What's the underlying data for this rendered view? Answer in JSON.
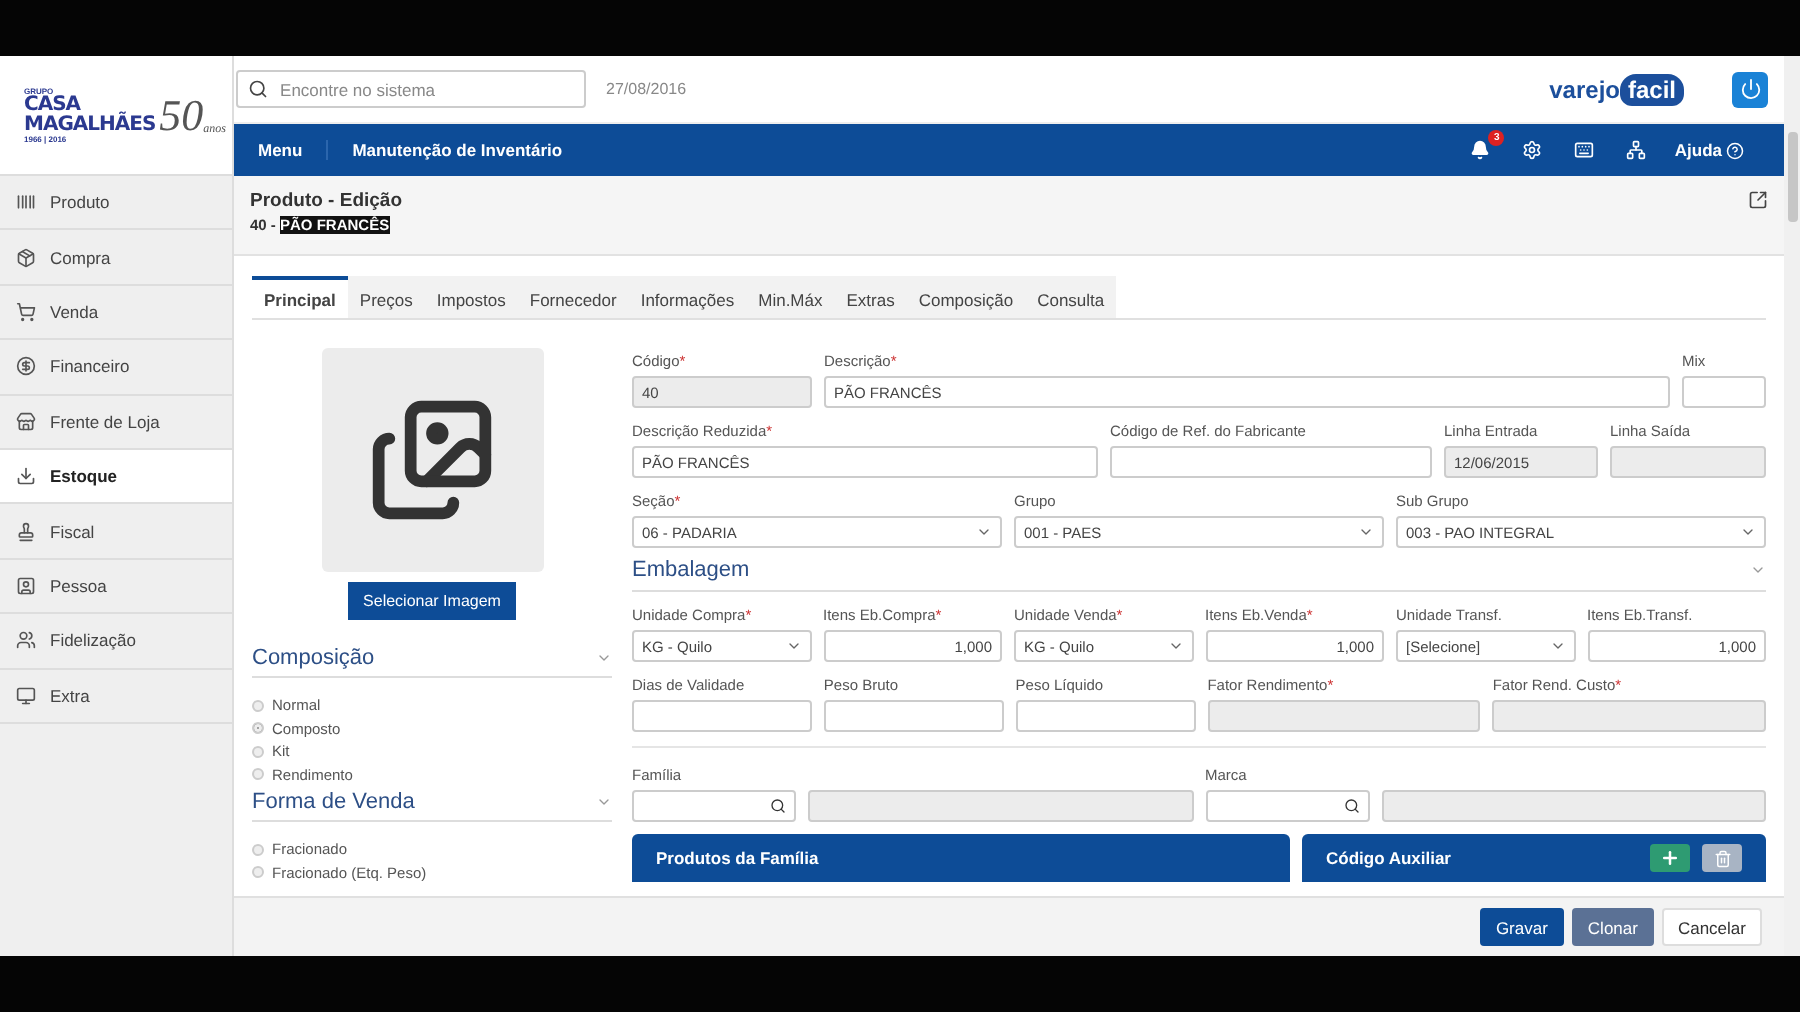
{
  "logo": {
    "group": "GRUPO",
    "line1": "CASA",
    "line2": "MAGALHÃES",
    "years": "1966 | 2016",
    "anniversary": "50",
    "anos": "anos"
  },
  "sidebar": {
    "items": [
      {
        "label": "Produto",
        "selected": false
      },
      {
        "label": "Compra",
        "selected": false
      },
      {
        "label": "Venda",
        "selected": false
      },
      {
        "label": "Financeiro",
        "selected": false
      },
      {
        "label": "Frente de Loja",
        "selected": false
      },
      {
        "label": "Estoque",
        "selected": true
      },
      {
        "label": "Fiscal",
        "selected": false
      },
      {
        "label": "Pessoa",
        "selected": false
      },
      {
        "label": "Fidelização",
        "selected": false
      },
      {
        "label": "Extra",
        "selected": false
      }
    ]
  },
  "topbar": {
    "search": {
      "placeholder": "Encontre no sistema"
    },
    "date": "27/08/2016",
    "brand": {
      "part1": "varejo",
      "part2": "facil"
    }
  },
  "navbar": {
    "menu": "Menu",
    "title": "Manutenção de Inventário",
    "notifications": "3",
    "help": "Ajuda"
  },
  "page": {
    "title": "Produto - Edição",
    "subtitle": {
      "prefix": "40 - ",
      "name": "PÃO FRANCÊS",
      "selected": true
    }
  },
  "tabs": [
    {
      "label": "Principal",
      "selected": true
    },
    {
      "label": "Preços",
      "selected": false
    },
    {
      "label": "Impostos",
      "selected": false
    },
    {
      "label": "Fornecedor",
      "selected": false
    },
    {
      "label": "Informações",
      "selected": false
    },
    {
      "label": "Min.Máx",
      "selected": false
    },
    {
      "label": "Extras",
      "selected": false
    },
    {
      "label": "Composição",
      "selected": false
    },
    {
      "label": "Consulta",
      "selected": false
    }
  ],
  "left": {
    "image_button": "Selecionar Imagem",
    "sections": [
      {
        "title": "Composição",
        "options": [
          {
            "label": "Normal",
            "selected": false
          },
          {
            "label": "Composto",
            "selected": true
          },
          {
            "label": "Kit",
            "selected": false
          },
          {
            "label": "Rendimento",
            "selected": false
          }
        ]
      },
      {
        "title": "Forma de Venda",
        "options": [
          {
            "label": "Fracionado",
            "selected": false
          },
          {
            "label": "Fracionado (Etq. Peso)",
            "selected": false
          }
        ]
      }
    ]
  },
  "form": {
    "rows": [
      [
        {
          "label": "Código",
          "required_mark": "*",
          "kind": "text",
          "value": "40",
          "disabled": true
        },
        {
          "label": "Descrição",
          "required_mark": "*",
          "kind": "text",
          "value": "PÃO FRANCÊS",
          "disabled": false
        },
        {
          "label": "Mix",
          "kind": "text",
          "disabled": false
        }
      ],
      [
        {
          "label": "Descrição Reduzida",
          "required_mark": "*",
          "kind": "text",
          "value": "PÃO FRANCÊS",
          "disabled": false
        },
        {
          "label": "Código de Ref. do Fabricante",
          "kind": "text",
          "disabled": false
        },
        {
          "label": "Linha Entrada",
          "kind": "text",
          "value": "12/06/2015",
          "disabled": true
        },
        {
          "label": "Linha Saída",
          "kind": "text",
          "disabled": true
        }
      ],
      [
        {
          "label": "Seção",
          "required_mark": "*",
          "kind": "select",
          "value": "06 - PADARIA",
          "disabled": false
        },
        {
          "label": "Grupo",
          "kind": "select",
          "value": "001 - PAES",
          "disabled": false
        },
        {
          "label": "Sub Grupo",
          "kind": "select",
          "value": "003 - PAO INTEGRAL",
          "disabled": false
        }
      ],
      {
        "heading": "Embalagem"
      },
      [
        {
          "label": "Unidade Compra",
          "required_mark": "*",
          "kind": "select",
          "value": "KG - Quilo",
          "disabled": false
        },
        {
          "label": "Itens Eb.Compra",
          "required_mark": "*",
          "kind": "number",
          "value": "1,000",
          "disabled": false
        },
        {
          "label": "Unidade Venda",
          "required_mark": "*",
          "kind": "select",
          "value": "KG - Quilo",
          "disabled": false
        },
        {
          "label": "Itens Eb.Venda",
          "required_mark": "*",
          "kind": "number",
          "value": "1,000",
          "disabled": false
        },
        {
          "label": "Unidade Transf.",
          "kind": "select",
          "value": "[Selecione]",
          "disabled": false
        },
        {
          "label": "Itens Eb.Transf.",
          "kind": "number",
          "value": "1,000",
          "disabled": false
        }
      ],
      [
        {
          "label": "Dias de Validade",
          "kind": "text",
          "disabled": false
        },
        {
          "label": "Peso Bruto",
          "kind": "text",
          "disabled": false
        },
        {
          "label": "Peso Líquido",
          "kind": "text",
          "disabled": false
        },
        {
          "label": "Fator Rendimento",
          "required_mark": "*",
          "kind": "text",
          "disabled": true
        },
        {
          "label": "Fator Rend. Custo",
          "required_mark": "*",
          "kind": "text",
          "disabled": true
        }
      ],
      {
        "divider": true
      },
      [
        {
          "label": "Família",
          "kind": "lookup",
          "disabled": false
        },
        {
          "label": "Marca",
          "kind": "lookup",
          "disabled": false
        }
      ]
    ]
  },
  "panels": [
    {
      "title": "Produtos da Família",
      "actions": false
    },
    {
      "title": "Código Auxiliar",
      "actions": true
    }
  ],
  "footer": {
    "buttons": [
      {
        "label": "Gravar",
        "kind": "primary"
      },
      {
        "label": "Clonar",
        "kind": "secondary"
      },
      {
        "label": "Cancelar",
        "kind": "default"
      }
    ]
  }
}
